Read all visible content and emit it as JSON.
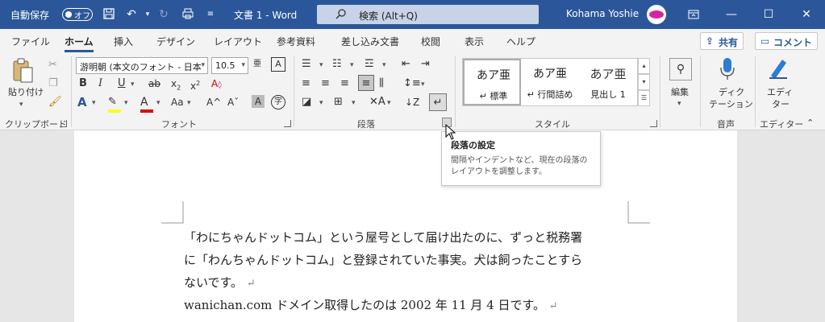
{
  "titlebar": {
    "autosave_label": "自動保存",
    "autosave_state": "オフ",
    "doc_title": "文書 1  -  Word",
    "search_placeholder": "検索 (Alt+Q)",
    "user_name": "Kohama Yoshie",
    "colors": {
      "bg": "#2b579a",
      "search_bg": "#c7d3e6"
    }
  },
  "tabs": [
    "ファイル",
    "ホーム",
    "挿入",
    "デザイン",
    "レイアウト",
    "参考資料",
    "差し込み文書",
    "校閲",
    "表示",
    "ヘルプ"
  ],
  "active_tab": "ホーム",
  "share_label": "共有",
  "comment_label": "コメント",
  "clipboard": {
    "paste_label": "貼り付け",
    "group_label": "クリップボード"
  },
  "font": {
    "font_name": "游明朝 (本文のフォント - 日本",
    "font_size": "10.5",
    "group_label": "フォント"
  },
  "paragraph": {
    "group_label": "段落"
  },
  "styles": {
    "group_label": "スタイル",
    "items": [
      {
        "sample": "あア亜",
        "name": "↵ 標準"
      },
      {
        "sample": "あア亜",
        "name": "↵ 行間詰め"
      },
      {
        "sample": "あア亜",
        "name": "見出し 1"
      }
    ]
  },
  "editing": {
    "label": "編集"
  },
  "voice": {
    "label1": "ディク",
    "label2": "テーション",
    "group_label": "音声"
  },
  "editor": {
    "label1": "エディ",
    "label2": "ター",
    "group_label": "エディター"
  },
  "tooltip": {
    "title": "段落の設定",
    "desc1": "間隔やインデントなど、現在の段落の",
    "desc2": "レイアウトを調整します。"
  },
  "document": {
    "lines": [
      "「わにちゃんドットコム」という屋号として届け出たのに、ずっと税務署",
      "に「わんちゃんドットコム」と登録されていた事実。犬は飼ったことすら",
      "ないです。",
      "wanichan.com ドメイン取得したのは 2002 年 11 月 4 日です。"
    ],
    "para_mark": "↵"
  }
}
